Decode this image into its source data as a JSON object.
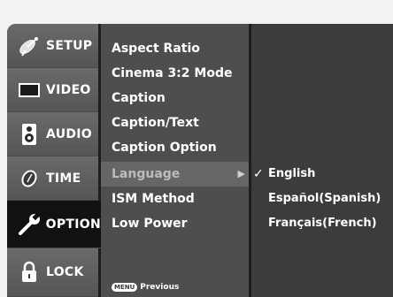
{
  "nav": {
    "items": [
      {
        "label": "SETUP",
        "icon": "satellite-dish-icon"
      },
      {
        "label": "VIDEO",
        "icon": "tv-screen-icon"
      },
      {
        "label": "AUDIO",
        "icon": "speaker-icon"
      },
      {
        "label": "TIME",
        "icon": "clock-icon"
      },
      {
        "label": "OPTION",
        "icon": "wrench-icon",
        "active": true
      },
      {
        "label": "LOCK",
        "icon": "padlock-icon"
      }
    ]
  },
  "submenu": {
    "items": [
      {
        "label": "Aspect Ratio"
      },
      {
        "label": "Cinema 3:2 Mode"
      },
      {
        "label": "Caption"
      },
      {
        "label": "Caption/Text"
      },
      {
        "label": "Caption Option"
      },
      {
        "label": "Language",
        "selected": true,
        "arrow": "▶"
      },
      {
        "label": "ISM Method"
      },
      {
        "label": "Low Power"
      }
    ],
    "footer": {
      "key_label": "MENU",
      "label": "Previous"
    }
  },
  "options": {
    "items": [
      {
        "label": "English",
        "check": "✓",
        "checked": true
      },
      {
        "label": "Español(Spanish)",
        "check": ""
      },
      {
        "label": "Français(French)",
        "check": ""
      }
    ]
  },
  "colors": {
    "page_background": "#f2f2f2",
    "nav_background": "#5a5a5a",
    "nav_active": "#111111",
    "submenu_background": "#4e4e4e",
    "submenu_selected": "#666666",
    "options_background": "#3c3c3c",
    "text": "#ffffff"
  }
}
